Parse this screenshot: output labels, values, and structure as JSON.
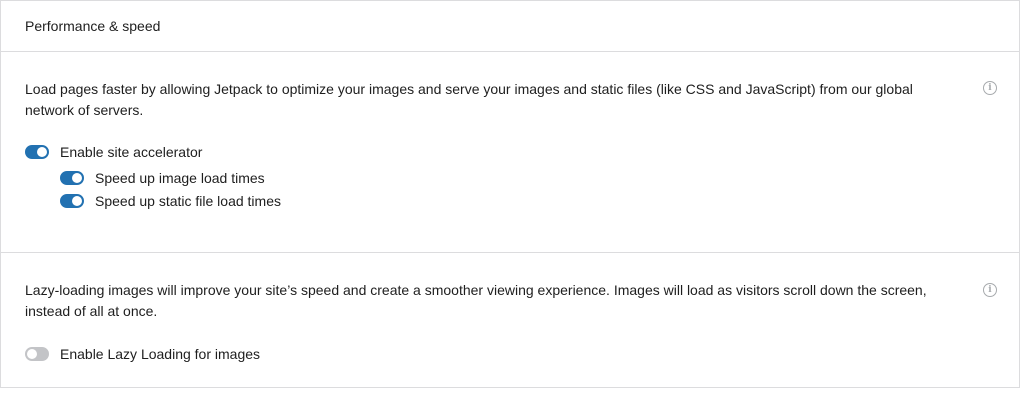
{
  "card": {
    "title": "Performance & speed"
  },
  "accelerator": {
    "description": "Load pages faster by allowing Jetpack to optimize your images and serve your images and static files (like CSS and JavaScript) from our global network of servers.",
    "info_icon": "info-icon",
    "main_toggle": {
      "label": "Enable site accelerator",
      "state": "on"
    },
    "sub_toggles": [
      {
        "label": "Speed up image load times",
        "state": "on"
      },
      {
        "label": "Speed up static file load times",
        "state": "on"
      }
    ]
  },
  "lazy_loading": {
    "description": "Lazy-loading images will improve your site’s speed and create a smoother viewing experience. Images will load as visitors scroll down the screen, instead of all at once.",
    "info_icon": "info-icon",
    "toggle": {
      "label": "Enable Lazy Loading for images",
      "state": "off"
    }
  },
  "colors": {
    "toggle_on": "#2271b1",
    "toggle_off": "#c3c4c7",
    "border": "#dcdcde"
  }
}
